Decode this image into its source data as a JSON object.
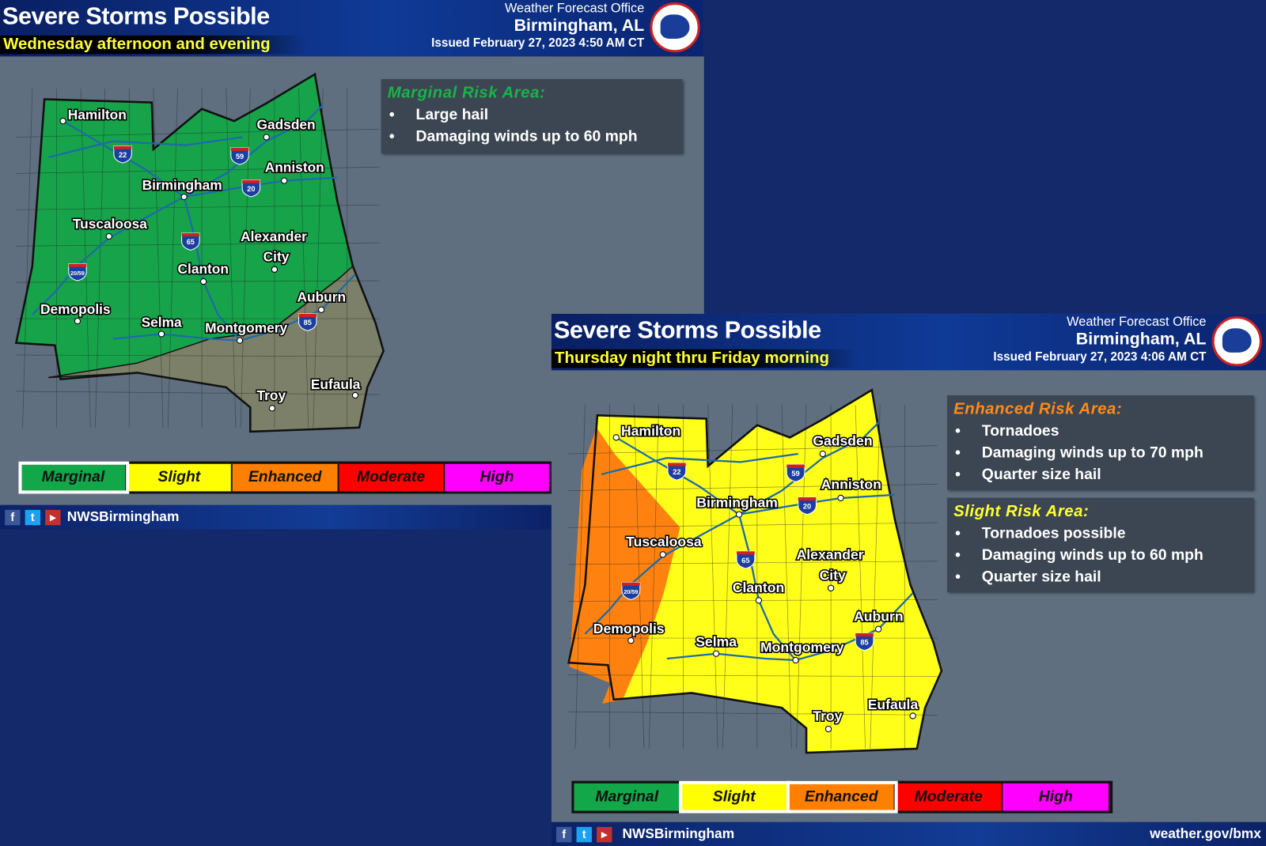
{
  "panels": [
    {
      "title": "Severe Storms Possible",
      "subtitle": "Wednesday afternoon and evening",
      "office": "Weather Forecast Office",
      "location": "Birmingham, AL",
      "issued": "Issued February 27, 2023 4:50 AM CT",
      "risk_boxes": [
        {
          "heading": "Marginal Risk Area:",
          "color": "#19b34a",
          "items": [
            "Large hail",
            "Damaging winds up to 60 mph"
          ]
        }
      ],
      "selected_legend": [
        "Marginal"
      ],
      "map_colors": {
        "base": "#16a34a",
        "east": "#7c8068"
      }
    },
    {
      "title": "Severe Storms Possible",
      "subtitle": "Thursday night thru Friday morning",
      "office": "Weather Forecast Office",
      "location": "Birmingham, AL",
      "issued": "Issued February 27, 2023 4:06 AM CT",
      "risk_boxes": [
        {
          "heading": "Enhanced Risk Area:",
          "color": "#ff8a1a",
          "items": [
            "Tornadoes",
            "Damaging winds up to 70 mph",
            "Quarter size hail"
          ]
        },
        {
          "heading": "Slight Risk Area:",
          "color": "#ffff33",
          "items": [
            "Tornadoes possible",
            "Damaging winds up to 60 mph",
            "Quarter size hail"
          ]
        }
      ],
      "selected_legend": [
        "Slight",
        "Enhanced"
      ],
      "map_colors": {
        "base": "#ffff1a",
        "west": "#ff8210"
      }
    }
  ],
  "legend": [
    {
      "label": "Marginal",
      "color": "#12a84a"
    },
    {
      "label": "Slight",
      "color": "#ffff00"
    },
    {
      "label": "Enhanced",
      "color": "#ff8000"
    },
    {
      "label": "Moderate",
      "color": "#ff0000"
    },
    {
      "label": "High",
      "color": "#ff00ff"
    }
  ],
  "cities": [
    "Hamilton",
    "Gadsden",
    "Anniston",
    "Birmingham",
    "Tuscaloosa",
    "Alexander",
    "City",
    "Clanton",
    "Demopolis",
    "Selma",
    "Montgomery",
    "Auburn",
    "Eufaula",
    "Troy"
  ],
  "interstates": [
    "22",
    "59",
    "20",
    "65",
    "20/59",
    "85"
  ],
  "footer": {
    "handle": "NWSBirmingham",
    "url": "weather.gov/bmx",
    "icons": [
      "facebook-icon",
      "twitter-icon",
      "youtube-icon"
    ]
  }
}
